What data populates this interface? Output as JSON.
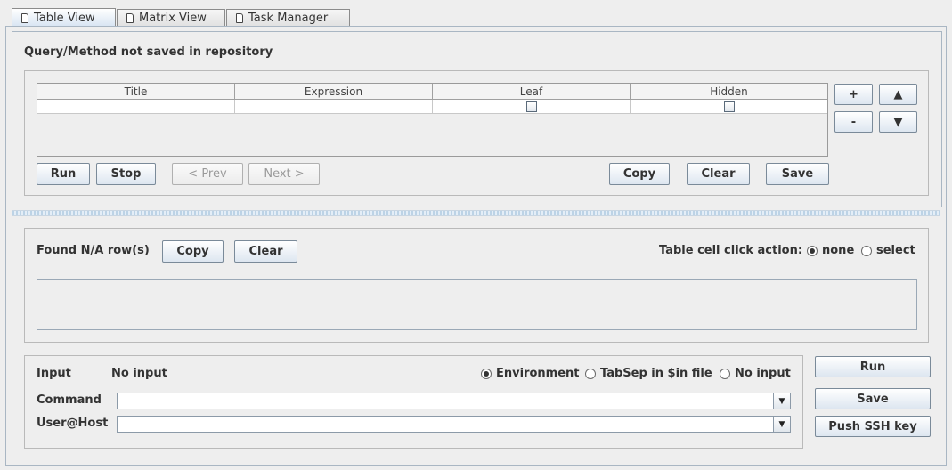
{
  "tabs": [
    {
      "label": "Table View",
      "icon": "document-icon",
      "active": true
    },
    {
      "label": "Matrix View",
      "icon": "document-icon",
      "active": false
    },
    {
      "label": "Task Manager",
      "icon": "document-icon",
      "active": false
    }
  ],
  "query": {
    "status": "Query/Method not saved in repository",
    "columns": [
      "Title",
      "Expression",
      "Leaf",
      "Hidden"
    ],
    "rows": [
      {
        "title": "",
        "expression": "",
        "leaf": false,
        "hidden": false
      }
    ],
    "side_buttons": {
      "add": "+",
      "remove": "-",
      "up": "▲",
      "down": "▼"
    },
    "buttons": {
      "run": "Run",
      "stop": "Stop",
      "prev": "< Prev",
      "next": "Next >",
      "copy": "Copy",
      "clear": "Clear",
      "save": "Save"
    }
  },
  "results": {
    "found_label": "Found N/A row(s)",
    "copy": "Copy",
    "clear": "Clear",
    "click_action_label": "Table cell click action:",
    "click_options": [
      {
        "label": "none",
        "selected": true
      },
      {
        "label": "select",
        "selected": false
      }
    ]
  },
  "execution": {
    "input_label": "Input",
    "input_value": "No input",
    "input_options": [
      {
        "label": "Environment",
        "selected": true
      },
      {
        "label": "TabSep in $in file",
        "selected": false
      },
      {
        "label": "No input",
        "selected": false
      }
    ],
    "command_label": "Command",
    "command_value": "",
    "userhost_label": "User@Host",
    "userhost_value": "",
    "buttons": {
      "run": "Run",
      "save": "Save",
      "push": "Push SSH key"
    }
  },
  "colors": {
    "accent": "#d7e4f2",
    "border": "#a9b6c3"
  }
}
